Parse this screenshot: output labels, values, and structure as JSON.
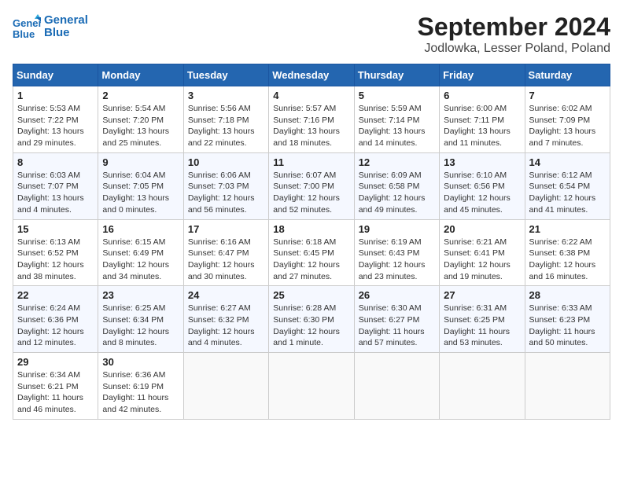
{
  "header": {
    "logo_line1": "General",
    "logo_line2": "Blue",
    "title": "September 2024",
    "subtitle": "Jodlowka, Lesser Poland, Poland"
  },
  "days_of_week": [
    "Sunday",
    "Monday",
    "Tuesday",
    "Wednesday",
    "Thursday",
    "Friday",
    "Saturday"
  ],
  "weeks": [
    [
      {
        "day": "1",
        "info": "Sunrise: 5:53 AM\nSunset: 7:22 PM\nDaylight: 13 hours\nand 29 minutes."
      },
      {
        "day": "2",
        "info": "Sunrise: 5:54 AM\nSunset: 7:20 PM\nDaylight: 13 hours\nand 25 minutes."
      },
      {
        "day": "3",
        "info": "Sunrise: 5:56 AM\nSunset: 7:18 PM\nDaylight: 13 hours\nand 22 minutes."
      },
      {
        "day": "4",
        "info": "Sunrise: 5:57 AM\nSunset: 7:16 PM\nDaylight: 13 hours\nand 18 minutes."
      },
      {
        "day": "5",
        "info": "Sunrise: 5:59 AM\nSunset: 7:14 PM\nDaylight: 13 hours\nand 14 minutes."
      },
      {
        "day": "6",
        "info": "Sunrise: 6:00 AM\nSunset: 7:11 PM\nDaylight: 13 hours\nand 11 minutes."
      },
      {
        "day": "7",
        "info": "Sunrise: 6:02 AM\nSunset: 7:09 PM\nDaylight: 13 hours\nand 7 minutes."
      }
    ],
    [
      {
        "day": "8",
        "info": "Sunrise: 6:03 AM\nSunset: 7:07 PM\nDaylight: 13 hours\nand 4 minutes."
      },
      {
        "day": "9",
        "info": "Sunrise: 6:04 AM\nSunset: 7:05 PM\nDaylight: 13 hours\nand 0 minutes."
      },
      {
        "day": "10",
        "info": "Sunrise: 6:06 AM\nSunset: 7:03 PM\nDaylight: 12 hours\nand 56 minutes."
      },
      {
        "day": "11",
        "info": "Sunrise: 6:07 AM\nSunset: 7:00 PM\nDaylight: 12 hours\nand 52 minutes."
      },
      {
        "day": "12",
        "info": "Sunrise: 6:09 AM\nSunset: 6:58 PM\nDaylight: 12 hours\nand 49 minutes."
      },
      {
        "day": "13",
        "info": "Sunrise: 6:10 AM\nSunset: 6:56 PM\nDaylight: 12 hours\nand 45 minutes."
      },
      {
        "day": "14",
        "info": "Sunrise: 6:12 AM\nSunset: 6:54 PM\nDaylight: 12 hours\nand 41 minutes."
      }
    ],
    [
      {
        "day": "15",
        "info": "Sunrise: 6:13 AM\nSunset: 6:52 PM\nDaylight: 12 hours\nand 38 minutes."
      },
      {
        "day": "16",
        "info": "Sunrise: 6:15 AM\nSunset: 6:49 PM\nDaylight: 12 hours\nand 34 minutes."
      },
      {
        "day": "17",
        "info": "Sunrise: 6:16 AM\nSunset: 6:47 PM\nDaylight: 12 hours\nand 30 minutes."
      },
      {
        "day": "18",
        "info": "Sunrise: 6:18 AM\nSunset: 6:45 PM\nDaylight: 12 hours\nand 27 minutes."
      },
      {
        "day": "19",
        "info": "Sunrise: 6:19 AM\nSunset: 6:43 PM\nDaylight: 12 hours\nand 23 minutes."
      },
      {
        "day": "20",
        "info": "Sunrise: 6:21 AM\nSunset: 6:41 PM\nDaylight: 12 hours\nand 19 minutes."
      },
      {
        "day": "21",
        "info": "Sunrise: 6:22 AM\nSunset: 6:38 PM\nDaylight: 12 hours\nand 16 minutes."
      }
    ],
    [
      {
        "day": "22",
        "info": "Sunrise: 6:24 AM\nSunset: 6:36 PM\nDaylight: 12 hours\nand 12 minutes."
      },
      {
        "day": "23",
        "info": "Sunrise: 6:25 AM\nSunset: 6:34 PM\nDaylight: 12 hours\nand 8 minutes."
      },
      {
        "day": "24",
        "info": "Sunrise: 6:27 AM\nSunset: 6:32 PM\nDaylight: 12 hours\nand 4 minutes."
      },
      {
        "day": "25",
        "info": "Sunrise: 6:28 AM\nSunset: 6:30 PM\nDaylight: 12 hours\nand 1 minute."
      },
      {
        "day": "26",
        "info": "Sunrise: 6:30 AM\nSunset: 6:27 PM\nDaylight: 11 hours\nand 57 minutes."
      },
      {
        "day": "27",
        "info": "Sunrise: 6:31 AM\nSunset: 6:25 PM\nDaylight: 11 hours\nand 53 minutes."
      },
      {
        "day": "28",
        "info": "Sunrise: 6:33 AM\nSunset: 6:23 PM\nDaylight: 11 hours\nand 50 minutes."
      }
    ],
    [
      {
        "day": "29",
        "info": "Sunrise: 6:34 AM\nSunset: 6:21 PM\nDaylight: 11 hours\nand 46 minutes."
      },
      {
        "day": "30",
        "info": "Sunrise: 6:36 AM\nSunset: 6:19 PM\nDaylight: 11 hours\nand 42 minutes."
      },
      {
        "day": "",
        "info": ""
      },
      {
        "day": "",
        "info": ""
      },
      {
        "day": "",
        "info": ""
      },
      {
        "day": "",
        "info": ""
      },
      {
        "day": "",
        "info": ""
      }
    ]
  ]
}
